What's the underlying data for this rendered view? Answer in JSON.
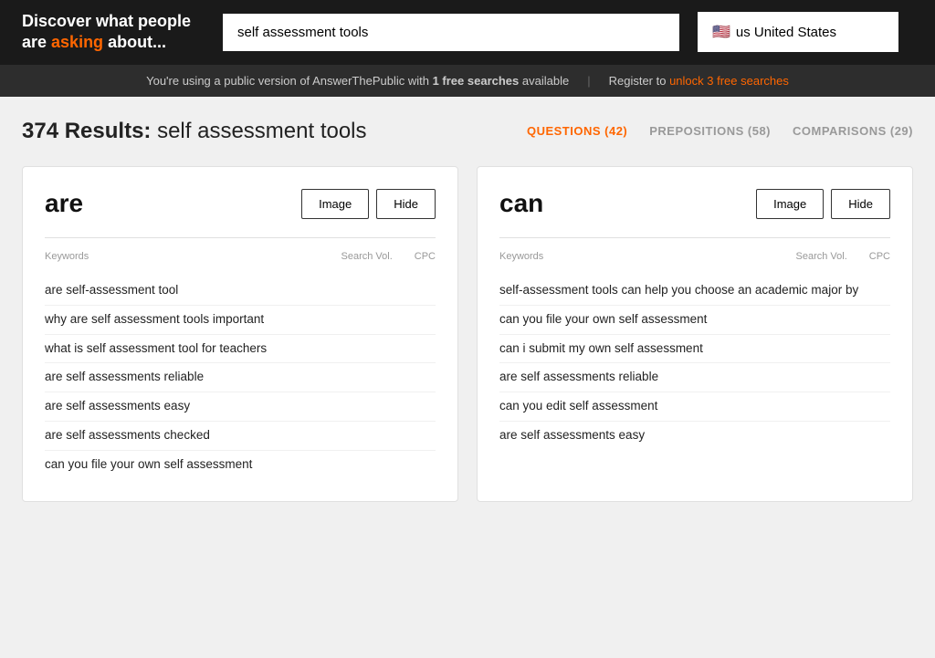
{
  "header": {
    "title_line1": "Discover what people",
    "title_line2": "are ",
    "title_asking": "asking",
    "title_line3": " about...",
    "search_value": "self assessment tools",
    "search_placeholder": "self assessment tools",
    "location_flag": "🇺🇸",
    "location_text": "us United States"
  },
  "notice": {
    "message": "You're using a public version of AnswerThePublic with ",
    "bold_part": "1 free searches",
    "message2": " available",
    "divider": "|",
    "register_text": "Register to ",
    "unlock_text": "unlock 3 free searches"
  },
  "results": {
    "count": "374",
    "label": "Results:",
    "query": "self assessment tools",
    "filters": [
      {
        "id": "questions",
        "label": "QUESTIONS",
        "count": "42",
        "active": true
      },
      {
        "id": "prepositions",
        "label": "PREPOSITIONS",
        "count": "58",
        "active": false
      },
      {
        "id": "comparisons",
        "label": "COMPARISONS",
        "count": "29",
        "active": false
      }
    ]
  },
  "cards": [
    {
      "id": "are-card",
      "title": "are",
      "image_btn": "Image",
      "hide_btn": "Hide",
      "col_keywords": "Keywords",
      "col_search_vol": "Search Vol.",
      "col_cpc": "CPC",
      "keywords": [
        "are self-assessment tool",
        "why are self assessment tools important",
        "what is self assessment tool for teachers",
        "are self assessments reliable",
        "are self assessments easy",
        "are self assessments checked",
        "can you file your own self assessment"
      ]
    },
    {
      "id": "can-card",
      "title": "can",
      "image_btn": "Image",
      "hide_btn": "Hide",
      "col_keywords": "Keywords",
      "col_search_vol": "Search Vol.",
      "col_cpc": "CPC",
      "keywords": [
        "self-assessment tools can help you choose an academic major by",
        "can you file your own self assessment",
        "can i submit my own self assessment",
        "are self assessments reliable",
        "can you edit self assessment",
        "are self assessments easy"
      ]
    }
  ]
}
